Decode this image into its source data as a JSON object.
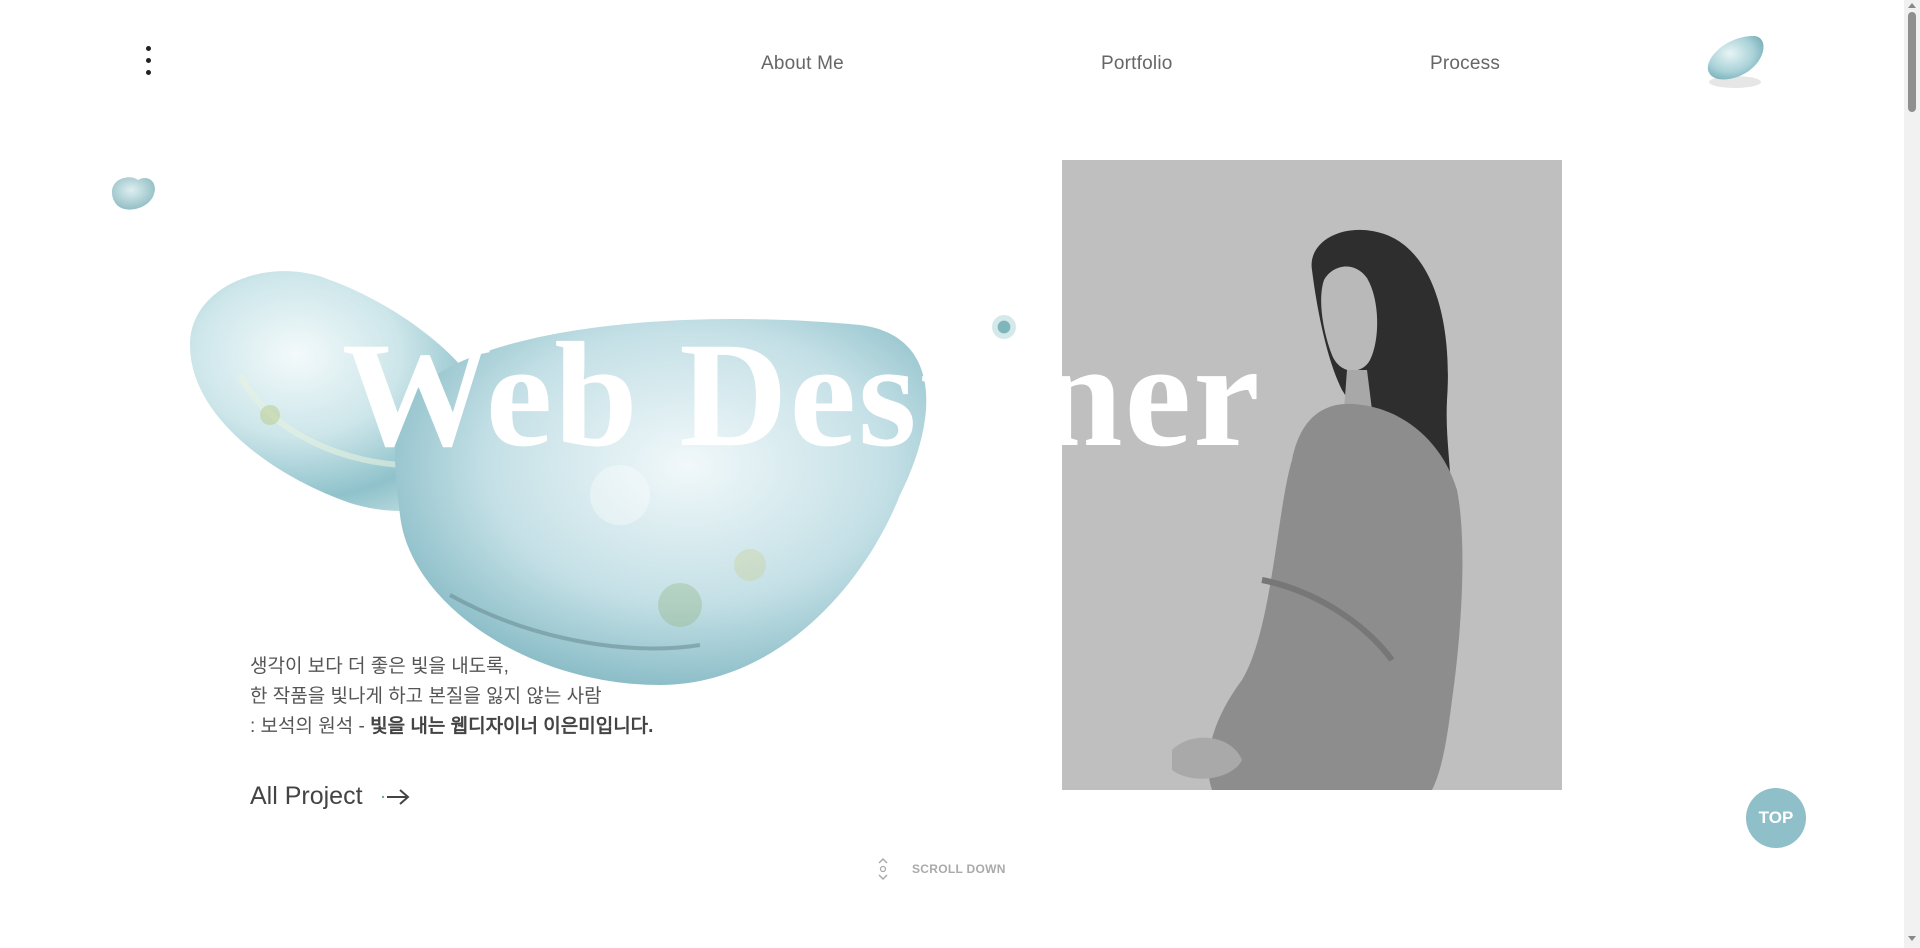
{
  "nav": {
    "menu_icon": "kebab-menu-icon",
    "links": [
      "About Me",
      "Portfolio",
      "Process"
    ]
  },
  "hero": {
    "headline": "Web Designer",
    "intro_line1": "생각이 보다 더 좋은 빛을 내도록,",
    "intro_line2": "한 작품을 빛나게 하고 본질을 잃지 않는 사람",
    "intro_line3_prefix": ": 보석의 원석 - ",
    "intro_line3_bold": "빛을 내는 웹디자이너 이은미입니다.",
    "cta_label": "All Project",
    "cta_icon": "arrow-right-icon"
  },
  "scroll": {
    "label": "SCROLL DOWN",
    "icon": "scroll-chevrons-icon"
  },
  "top_button": {
    "label": "TOP"
  },
  "colors": {
    "accent": "#8fbfc8",
    "photo_bg": "#bfbfbf",
    "text": "#555555"
  }
}
